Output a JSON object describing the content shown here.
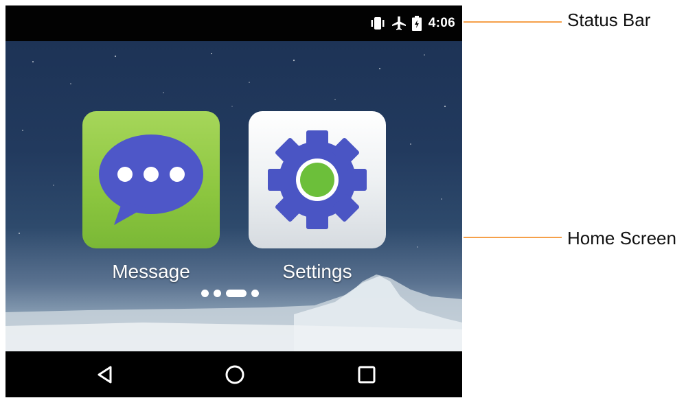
{
  "status_bar": {
    "time": "4:06",
    "icons": [
      "vibrate-icon",
      "airplane-mode-icon",
      "battery-charging-icon"
    ]
  },
  "apps": [
    {
      "label": "Message",
      "icon": "chat-bubble-icon",
      "color": "#8cc63f"
    },
    {
      "label": "Settings",
      "icon": "gear-icon",
      "color": "#4a55c4"
    }
  ],
  "page_indicator": {
    "count": 4,
    "active": 3
  },
  "nav_bar": {
    "buttons": [
      "back-icon",
      "home-icon",
      "recent-apps-icon"
    ]
  },
  "callouts": {
    "status_bar": "Status Bar",
    "home_screen": "Home Screen",
    "line_color": "#f5a04a"
  }
}
